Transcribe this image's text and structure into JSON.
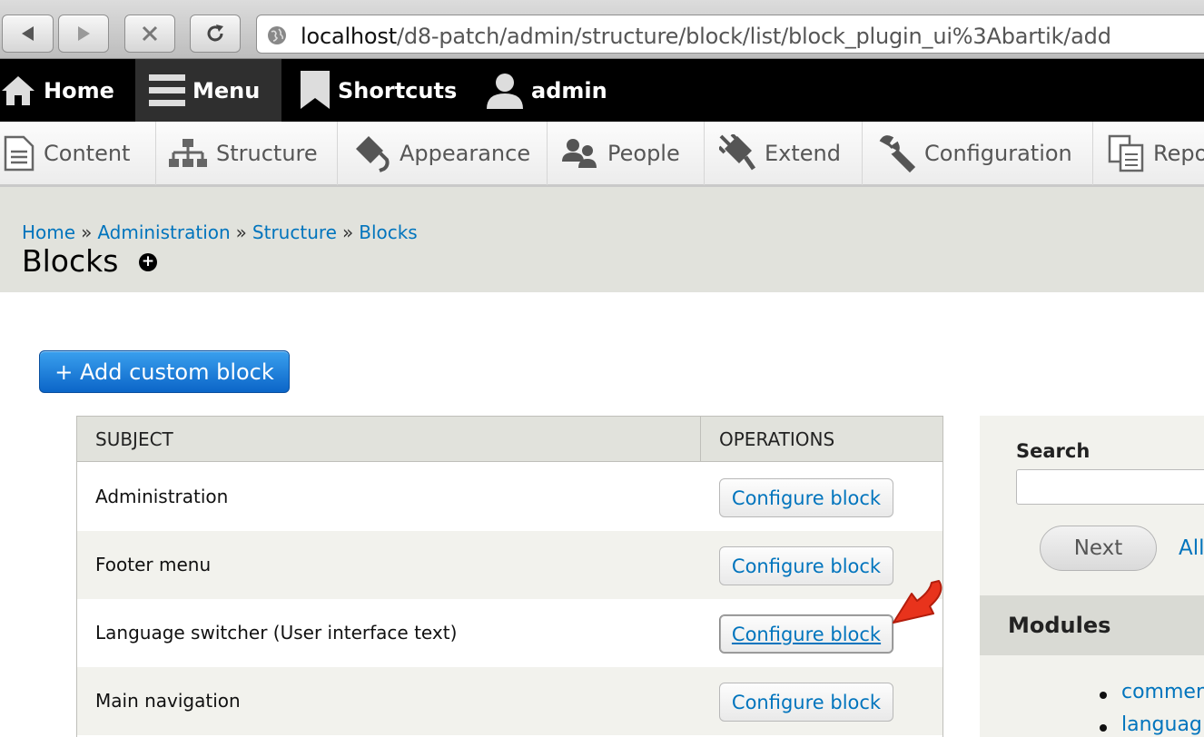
{
  "browser": {
    "url_host": "localhost",
    "url_path": "/d8-patch/admin/structure/block/list/block_plugin_ui%3Abartik/add"
  },
  "toolbar": {
    "home_label": "Home",
    "menu_label": "Menu",
    "shortcuts_label": "Shortcuts",
    "user_label": "admin"
  },
  "tray": {
    "items": [
      {
        "label": "Content",
        "icon": "document-icon"
      },
      {
        "label": "Structure",
        "icon": "sitemap-icon"
      },
      {
        "label": "Appearance",
        "icon": "paint-icon"
      },
      {
        "label": "People",
        "icon": "people-icon"
      },
      {
        "label": "Extend",
        "icon": "plug-icon"
      },
      {
        "label": "Configuration",
        "icon": "wrench-icon"
      },
      {
        "label": "Repo",
        "icon": "reports-icon"
      }
    ]
  },
  "breadcrumb": {
    "items": [
      "Home",
      "Administration",
      "Structure",
      "Blocks"
    ],
    "separator": "»"
  },
  "page": {
    "title": "Blocks",
    "add_button_label": "+ Add custom block"
  },
  "table": {
    "headers": {
      "subject": "SUBJECT",
      "operations": "OPERATIONS"
    },
    "rows": [
      {
        "subject": "Administration",
        "op": "Configure block"
      },
      {
        "subject": "Footer menu",
        "op": "Configure block"
      },
      {
        "subject": "Language switcher (User interface text)",
        "op": "Configure block"
      },
      {
        "subject": "Main navigation",
        "op": "Configure block"
      }
    ]
  },
  "sidebar": {
    "search_label": "Search",
    "search_value": "",
    "next_label": "Next",
    "all_label": "All",
    "modules_title": "Modules",
    "modules": [
      "commer",
      "languag"
    ]
  },
  "colors": {
    "link": "#0074bd",
    "add_button": "#1a7ad9",
    "annotation_arrow": "#e8331c"
  }
}
